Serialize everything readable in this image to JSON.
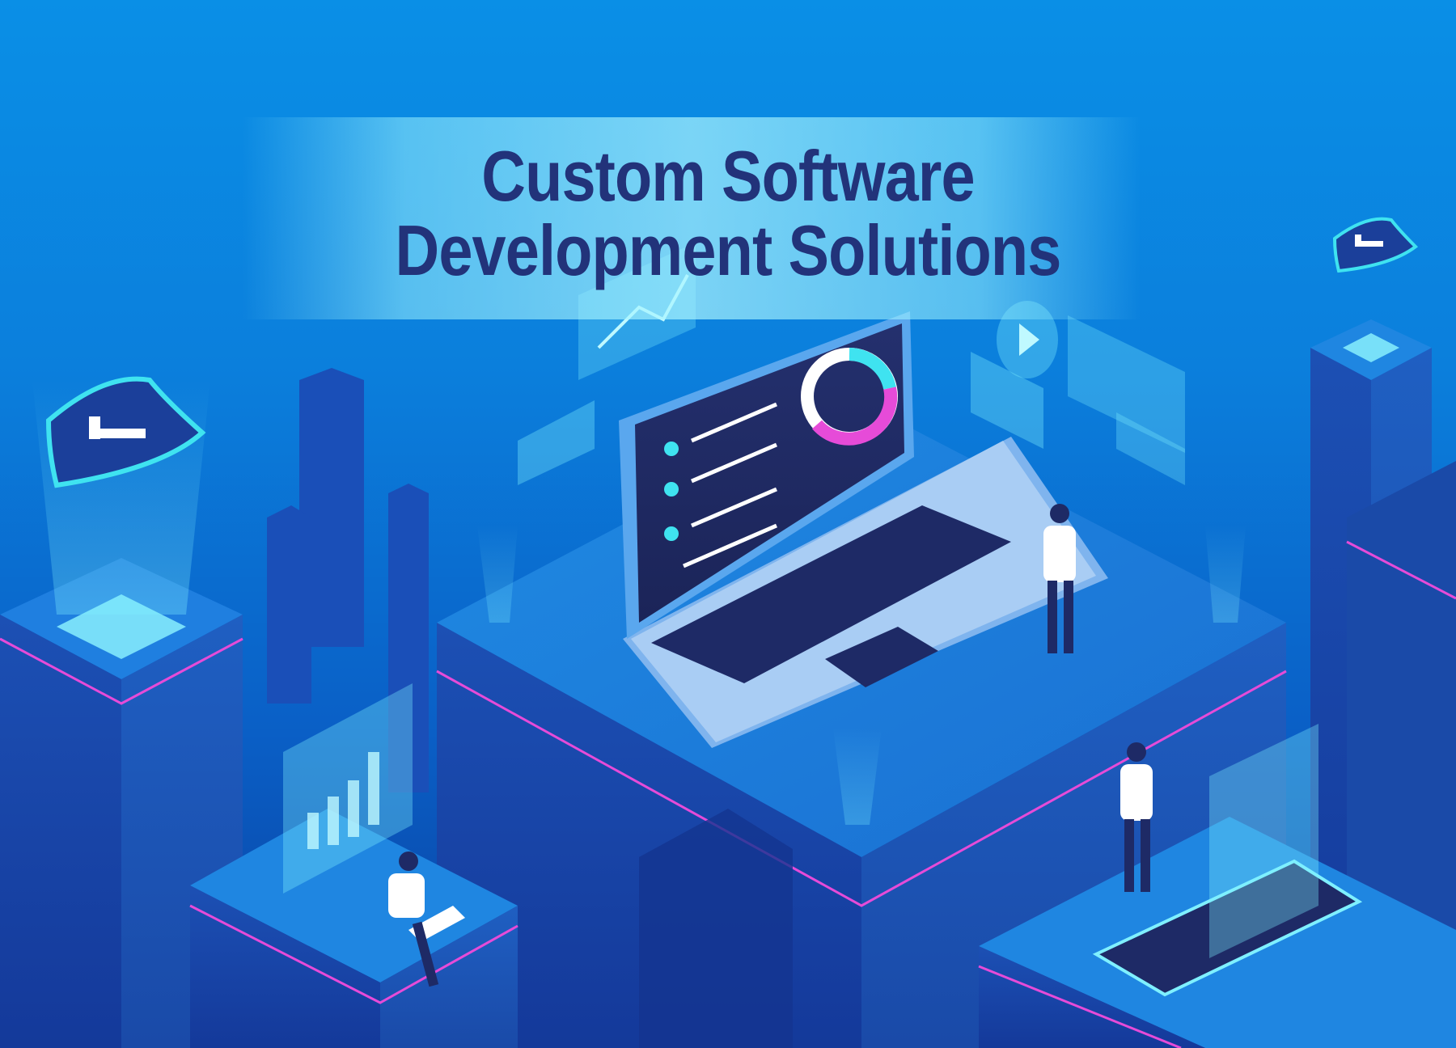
{
  "title": {
    "line1": "Custom Software",
    "line2": "Development Solutions"
  },
  "colors": {
    "background_top": "#0a8fe6",
    "background_bottom": "#0a3f9e",
    "title_text": "#22337a",
    "neon_accent": "#e64bd8",
    "cyan_accent": "#3fe3f0",
    "block_dark": "#163a93"
  },
  "illustration": {
    "icons": [
      "shield-icon",
      "shield-icon",
      "laptop-icon",
      "smartphone-icon",
      "bar-chart-icon",
      "donut-chart-icon",
      "image-icon",
      "play-icon",
      "line-graph-icon"
    ],
    "people": 3
  }
}
